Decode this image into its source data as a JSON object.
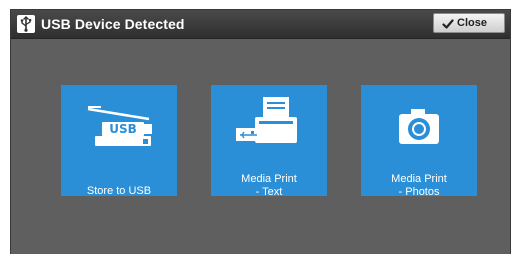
{
  "dialog": {
    "title": "USB Device Detected",
    "title_icon": "usb-icon",
    "close_label": "Close",
    "close_icon": "checkmark-icon"
  },
  "tiles": [
    {
      "line1": "Store to USB",
      "line2": "",
      "icon": "usb-scanner-icon"
    },
    {
      "line1": "Media Print",
      "line2": "- Text",
      "icon": "printer-usb-icon"
    },
    {
      "line1": "Media Print",
      "line2": "- Photos",
      "icon": "camera-icon"
    }
  ],
  "colors": {
    "tile": "#2a8fd6",
    "background": "#5f5f5f",
    "titlebar": "#333333"
  }
}
